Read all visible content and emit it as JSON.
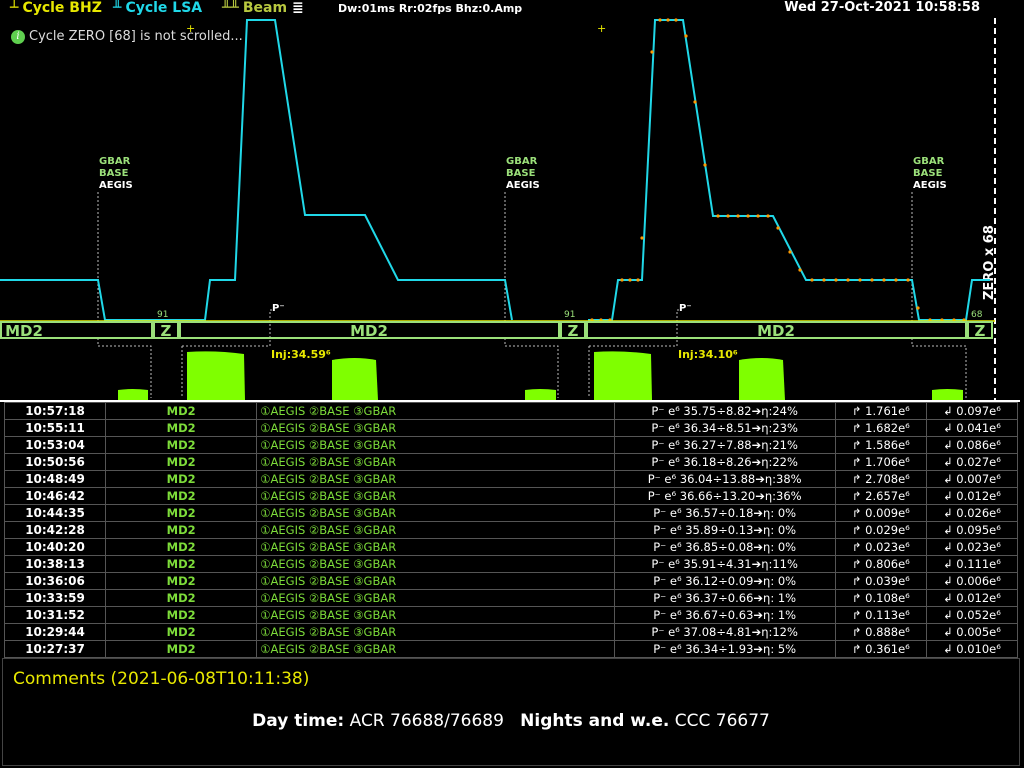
{
  "header": {
    "legend": [
      {
        "symbol": "┴",
        "label": "Cycle BHZ",
        "color": "#e8e800"
      },
      {
        "symbol": "╨",
        "label": "Cycle LSA",
        "color": "#20d8e8"
      },
      {
        "symbol": "╨╨",
        "label": "Beam",
        "color": "#b8c840",
        "extra": "≣"
      }
    ],
    "status": "Dw:01ms Rr:02fps Bhz:0.Amp",
    "datetime": "Wed 27-Oct-2021 10:58:58"
  },
  "notice": {
    "icon": "info-icon",
    "text": "Cycle ZERO [68] is not scrolled..."
  },
  "plot": {
    "zero_label": "ZERO x 68",
    "markers": [
      {
        "l1": "GBAR",
        "l2": "BASE",
        "l3": "AEGIS"
      },
      {
        "l1": "GBAR",
        "l2": "BASE",
        "l3": "AEGIS"
      },
      {
        "l1": "GBAR",
        "l2": "BASE",
        "l3": "AEGIS"
      }
    ],
    "pminus": "P⁻",
    "bar_segments": [
      "MD2",
      "Z",
      "MD2",
      "Z",
      "MD2",
      "Z"
    ],
    "z_numbers": [
      "91",
      "91",
      "68"
    ],
    "injections": [
      "Inj:34.59⁶",
      "Inj:34.10⁶"
    ],
    "colors": {
      "cycle": "#20d8e8",
      "yellow": "#e8e800",
      "green": "#7fff00",
      "bar_text": "#9be07a",
      "orange": "#ff9900"
    }
  },
  "table": {
    "rows": [
      {
        "time": "10:57:18",
        "mode": "MD2",
        "dest": "①AEGIS ②BASE ③GBAR",
        "pbar": "P⁻ e⁶ 35.75÷8.82➔η:24%",
        "up": "↱ 1.761e⁶",
        "down": "↲ 0.097e⁶"
      },
      {
        "time": "10:55:11",
        "mode": "MD2",
        "dest": "①AEGIS ②BASE ③GBAR",
        "pbar": "P⁻ e⁶ 36.34÷8.51➔η:23%",
        "up": "↱ 1.682e⁶",
        "down": "↲ 0.041e⁶"
      },
      {
        "time": "10:53:04",
        "mode": "MD2",
        "dest": "①AEGIS ②BASE ③GBAR",
        "pbar": "P⁻ e⁶ 36.27÷7.88➔η:21%",
        "up": "↱ 1.586e⁶",
        "down": "↲ 0.086e⁶"
      },
      {
        "time": "10:50:56",
        "mode": "MD2",
        "dest": "①AEGIS ②BASE ③GBAR",
        "pbar": "P⁻ e⁶ 36.18÷8.26➔η:22%",
        "up": "↱ 1.706e⁶",
        "down": "↲ 0.027e⁶"
      },
      {
        "time": "10:48:49",
        "mode": "MD2",
        "dest": "①AEGIS ②BASE ③GBAR",
        "pbar": "P⁻ e⁶ 36.04÷13.88➔η:38%",
        "up": "↱ 2.708e⁶",
        "down": "↲ 0.007e⁶"
      },
      {
        "time": "10:46:42",
        "mode": "MD2",
        "dest": "①AEGIS ②BASE ③GBAR",
        "pbar": "P⁻ e⁶ 36.66÷13.20➔η:36%",
        "up": "↱ 2.657e⁶",
        "down": "↲ 0.012e⁶"
      },
      {
        "time": "10:44:35",
        "mode": "MD2",
        "dest": "①AEGIS ②BASE ③GBAR",
        "pbar": "P⁻ e⁶ 36.57÷0.18➔η: 0%",
        "up": "↱ 0.009e⁶",
        "down": "↲ 0.026e⁶"
      },
      {
        "time": "10:42:28",
        "mode": "MD2",
        "dest": "①AEGIS ②BASE ③GBAR",
        "pbar": "P⁻ e⁶ 35.89÷0.13➔η: 0%",
        "up": "↱ 0.029e⁶",
        "down": "↲ 0.095e⁶"
      },
      {
        "time": "10:40:20",
        "mode": "MD2",
        "dest": "①AEGIS ②BASE ③GBAR",
        "pbar": "P⁻ e⁶ 36.85÷0.08➔η: 0%",
        "up": "↱ 0.023e⁶",
        "down": "↲ 0.023e⁶"
      },
      {
        "time": "10:38:13",
        "mode": "MD2",
        "dest": "①AEGIS ②BASE ③GBAR",
        "pbar": "P⁻ e⁶ 35.91÷4.31➔η:11%",
        "up": "↱ 0.806e⁶",
        "down": "↲ 0.111e⁶"
      },
      {
        "time": "10:36:06",
        "mode": "MD2",
        "dest": "①AEGIS ②BASE ③GBAR",
        "pbar": "P⁻ e⁶ 36.12÷0.09➔η: 0%",
        "up": "↱ 0.039e⁶",
        "down": "↲ 0.006e⁶"
      },
      {
        "time": "10:33:59",
        "mode": "MD2",
        "dest": "①AEGIS ②BASE ③GBAR",
        "pbar": "P⁻ e⁶ 36.37÷0.66➔η: 1%",
        "up": "↱ 0.108e⁶",
        "down": "↲ 0.012e⁶"
      },
      {
        "time": "10:31:52",
        "mode": "MD2",
        "dest": "①AEGIS ②BASE ③GBAR",
        "pbar": "P⁻ e⁶ 36.67÷0.63➔η: 1%",
        "up": "↱ 0.113e⁶",
        "down": "↲ 0.052e⁶"
      },
      {
        "time": "10:29:44",
        "mode": "MD2",
        "dest": "①AEGIS ②BASE ③GBAR",
        "pbar": "P⁻ e⁶ 37.08÷4.81➔η:12%",
        "up": "↱ 0.888e⁶",
        "down": "↲ 0.005e⁶"
      },
      {
        "time": "10:27:37",
        "mode": "MD2",
        "dest": "①AEGIS ②BASE ③GBAR",
        "pbar": "P⁻ e⁶ 36.34÷1.93➔η: 5%",
        "up": "↱ 0.361e⁶",
        "down": "↲ 0.010e⁶"
      }
    ]
  },
  "comments": {
    "title": "Comments (2021-06-08T10:11:38)",
    "day_label": "Day time:",
    "day_value": "ACR 76688/76689",
    "night_label": "Nights and w.e.",
    "night_value": "CCC 76677"
  }
}
